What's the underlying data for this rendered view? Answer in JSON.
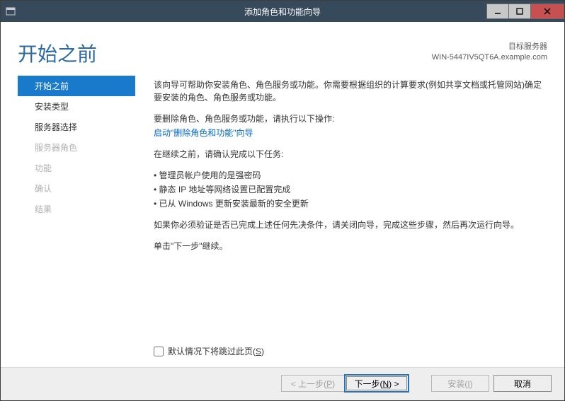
{
  "titlebar": {
    "title": "添加角色和功能向导"
  },
  "header": {
    "heading": "开始之前",
    "target_label": "目标服务器",
    "target_value": "WIN-5447IV5QT6A.example.com"
  },
  "sidebar": {
    "items": [
      {
        "label": "开始之前",
        "state": "active"
      },
      {
        "label": "安装类型",
        "state": "enabled"
      },
      {
        "label": "服务器选择",
        "state": "enabled"
      },
      {
        "label": "服务器角色",
        "state": "disabled"
      },
      {
        "label": "功能",
        "state": "disabled"
      },
      {
        "label": "确认",
        "state": "disabled"
      },
      {
        "label": "结果",
        "state": "disabled"
      }
    ]
  },
  "main": {
    "intro": "该向导可帮助你安装角色、角色服务或功能。你需要根据组织的计算要求(例如共享文档或托管网站)确定要安装的角色、角色服务或功能。",
    "remove_label": "要删除角色、角色服务或功能，请执行以下操作:",
    "remove_link": "启动\"删除角色和功能\"向导",
    "before_continue": "在继续之前，请确认完成以下任务:",
    "bullets": [
      "• 管理员帐户使用的是强密码",
      "• 静态 IP 地址等网络设置已配置完成",
      "• 已从 Windows 更新安装最新的安全更新"
    ],
    "verify_note": "如果你必须验证是否已完成上述任何先决条件，请关闭向导，完成这些步骤，然后再次运行向导。",
    "click_next": "单击\"下一步\"继续。"
  },
  "skip": {
    "label_pre": "默认情况下将跳过此页(",
    "label_hotkey": "S",
    "label_post": ")"
  },
  "footer": {
    "prev_pre": "< 上一步(",
    "prev_hot": "P",
    "prev_post": ")",
    "next_pre": "下一步(",
    "next_hot": "N",
    "next_post": ") >",
    "install_pre": "安装(",
    "install_hot": "I",
    "install_post": ")",
    "cancel": "取消"
  }
}
